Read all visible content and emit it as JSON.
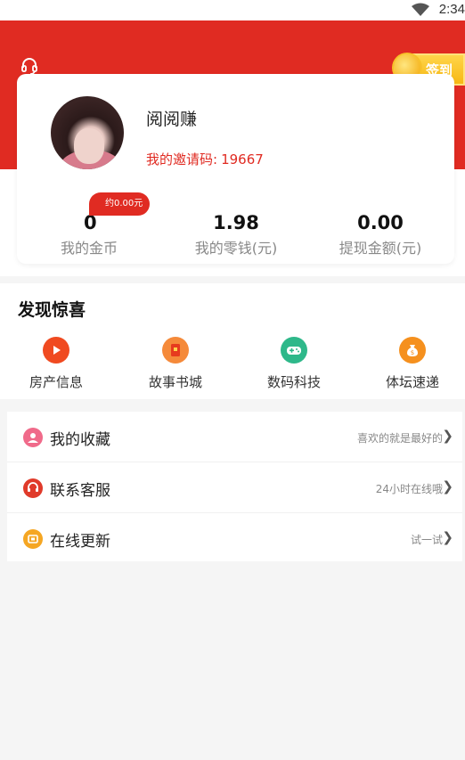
{
  "status_bar": {
    "time": "2:34"
  },
  "header": {
    "signin_label": "签到"
  },
  "profile": {
    "username": "阅阅赚",
    "invite_label": "我的邀请码:",
    "invite_code": "19667",
    "coin_badge": "约0.00元",
    "stats": [
      {
        "value": "0",
        "label": "我的金币"
      },
      {
        "value": "1.98",
        "label": "我的零钱(元)"
      },
      {
        "value": "0.00",
        "label": "提现金额(元)"
      }
    ]
  },
  "discover": {
    "title": "发现惊喜",
    "items": [
      {
        "label": "房产信息",
        "icon": "play-icon",
        "color": "#f04a20"
      },
      {
        "label": "故事书城",
        "icon": "book-icon",
        "color": "#f58a3a"
      },
      {
        "label": "数码科技",
        "icon": "gamepad-icon",
        "color": "#2eb88a"
      },
      {
        "label": "体坛速递",
        "icon": "moneybag-icon",
        "color": "#f5901e"
      }
    ]
  },
  "menu": [
    {
      "title": "我的收藏",
      "hint": "喜欢的就是最好的",
      "icon": "favorite-icon",
      "color": "#f06a8a"
    },
    {
      "title": "联系客服",
      "hint": "24小时在线哦",
      "icon": "customer-service-icon",
      "color": "#e03a2a"
    },
    {
      "title": "在线更新",
      "hint": "试一试",
      "icon": "update-icon",
      "color": "#f5a623"
    }
  ]
}
